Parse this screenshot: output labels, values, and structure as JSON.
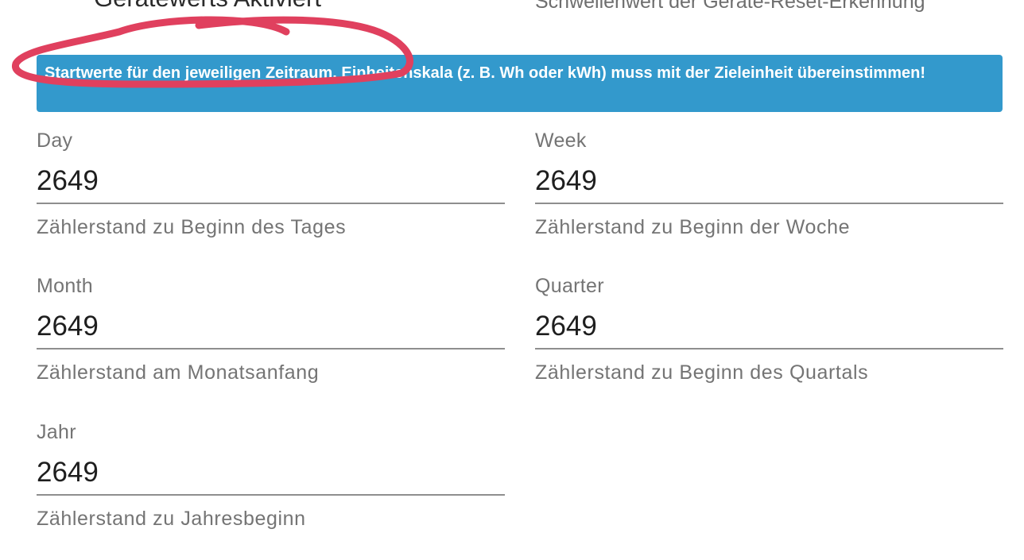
{
  "header": {
    "left_heading": "Gerätewerts Aktiviert",
    "right_heading": "Schwellenwert der Geräte-Reset-Erkennung"
  },
  "info_banner": {
    "text": "Startwerte für den jeweiligen Zeitraum. Einheitenskala (z. B. Wh oder kWh) muss mit der Zieleinheit übereinstimmen!",
    "color": "#3399cc"
  },
  "fields": {
    "day": {
      "label": "Day",
      "value": "2649",
      "help": "Zählerstand zu Beginn des Tages"
    },
    "week": {
      "label": "Week",
      "value": "2649",
      "help": "Zählerstand zu Beginn der Woche"
    },
    "month": {
      "label": "Month",
      "value": "2649",
      "help": "Zählerstand am Monatsanfang"
    },
    "quarter": {
      "label": "Quarter",
      "value": "2649",
      "help": "Zählerstand zu Beginn des Quartals"
    },
    "year": {
      "label": "Jahr",
      "value": "2649",
      "help": "Zählerstand zu Jahresbeginn"
    }
  },
  "annotation_color": "#e0405e"
}
